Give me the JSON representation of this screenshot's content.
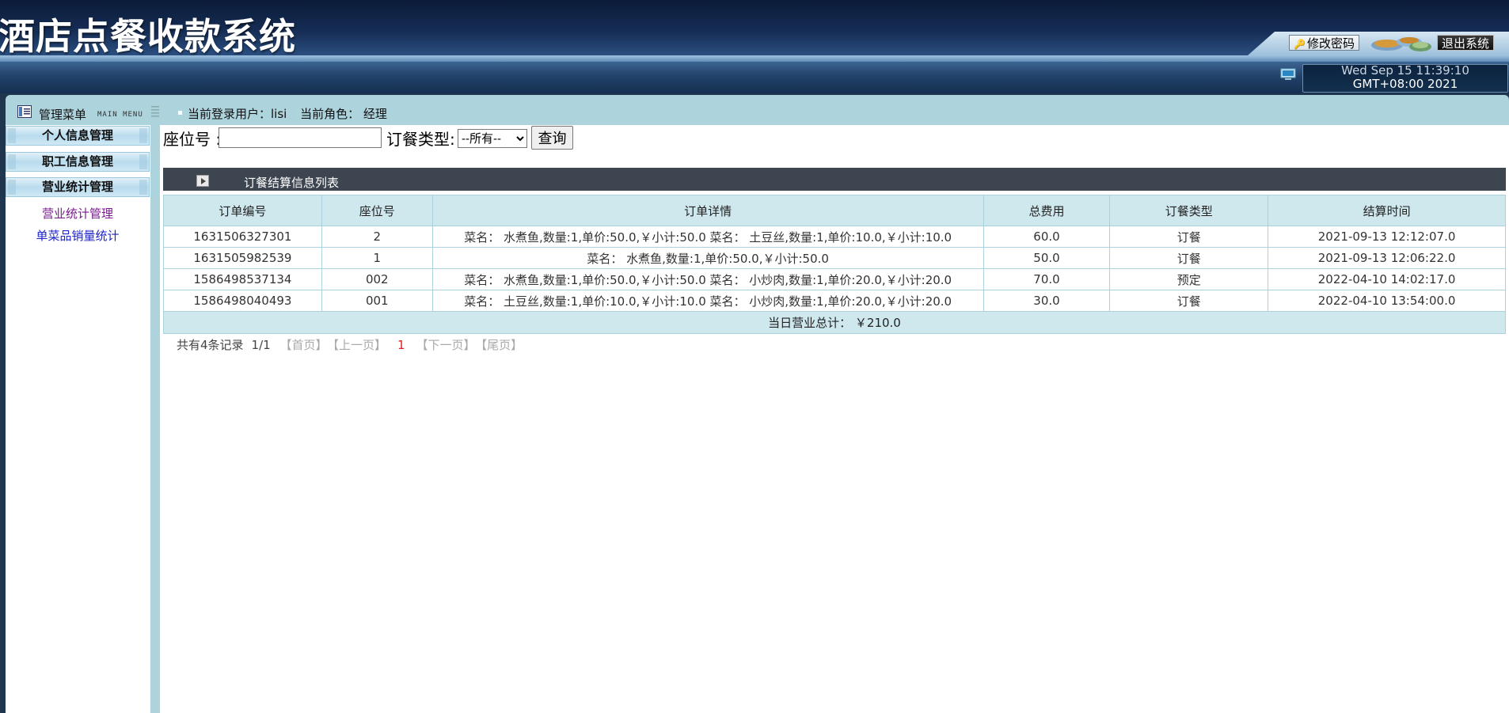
{
  "header": {
    "app_title": "酒店点餐收款系统",
    "change_password_label": "修改密码",
    "logout_label": "退出系统",
    "datetime_line1": "Wed Sep 15 11:39:10",
    "datetime_line2": "GMT+08:00 2021"
  },
  "menubar": {
    "title": "管理菜单",
    "title_en": "MAIN MENU",
    "current_user": "当前登录用户：lisi",
    "current_role": "当前角色： 经理"
  },
  "sidebar": {
    "groups": [
      {
        "label": "个人信息管理"
      },
      {
        "label": "职工信息管理"
      },
      {
        "label": "营业统计管理"
      }
    ],
    "links": [
      {
        "label": "营业统计管理"
      },
      {
        "label": "单菜品销量统计"
      }
    ]
  },
  "search": {
    "seat_label": "座位号 :",
    "seat_value": "",
    "type_label": "订餐类型:",
    "type_selected": "--所有--",
    "query_label": "查询"
  },
  "list": {
    "title": "订餐结算信息列表",
    "columns": [
      "订单编号",
      "座位号",
      "订单详情",
      "总费用",
      "订餐类型",
      "结算时间"
    ],
    "rows": [
      [
        "1631506327301",
        "2",
        "菜名： 水煮鱼,数量:1,单价:50.0,￥小计:50.0 菜名： 土豆丝,数量:1,单价:10.0,￥小计:10.0",
        "60.0",
        "订餐",
        "2021-09-13 12:12:07.0"
      ],
      [
        "1631505982539",
        "1",
        "菜名： 水煮鱼,数量:1,单价:50.0,￥小计:50.0",
        "50.0",
        "订餐",
        "2021-09-13 12:06:22.0"
      ],
      [
        "1586498537134",
        "002",
        "菜名： 水煮鱼,数量:1,单价:50.0,￥小计:50.0 菜名： 小炒肉,数量:1,单价:20.0,￥小计:20.0",
        "70.0",
        "预定",
        "2022-04-10 14:02:17.0"
      ],
      [
        "1586498040493",
        "001",
        "菜名： 土豆丝,数量:1,单价:10.0,￥小计:10.0 菜名： 小炒肉,数量:1,单价:20.0,￥小计:20.0",
        "30.0",
        "订餐",
        "2022-04-10 13:54:00.0"
      ]
    ],
    "total_label": "当日营业总计： ￥210.0"
  },
  "pager": {
    "total_records": "共有4条记录",
    "position": "1/1",
    "first": "【首页】",
    "prev": "【上一页】",
    "current": "1",
    "next": "【下一页】",
    "last": "【尾页】"
  },
  "colors": {
    "header_dark": "#0d1e3d",
    "menubar": "#add3dc",
    "table_header": "#cfe8ee",
    "table_border": "#a9d2dd",
    "list_bar": "#3d4650"
  }
}
